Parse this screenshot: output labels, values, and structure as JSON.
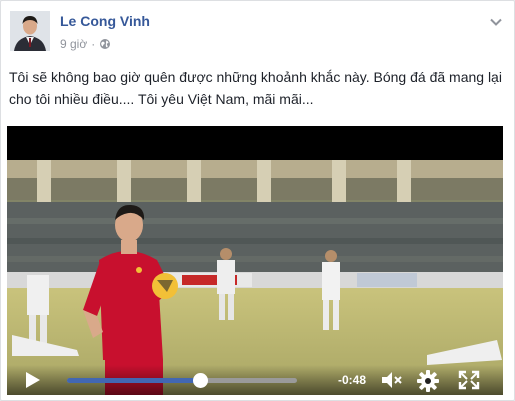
{
  "post": {
    "author": "Le Cong Vinh",
    "time": "9 giờ",
    "privacy_icon": "globe-icon",
    "message": "Tôi sẽ không bao giờ quên được những khoảnh khắc này. Bóng đá đã mang lại cho tôi nhiều điều.... Tôi yêu Việt Nam, mãi mãi..."
  },
  "video": {
    "progress": 0.58,
    "time_remaining": "-0:48",
    "icons": [
      "play-icon",
      "volume-muted-icon",
      "settings-gear-icon",
      "fullscreen-icon"
    ],
    "colors": {
      "progress": "#4267b2",
      "jersey": "#c8102e",
      "pitch": "#c7c27a"
    }
  }
}
